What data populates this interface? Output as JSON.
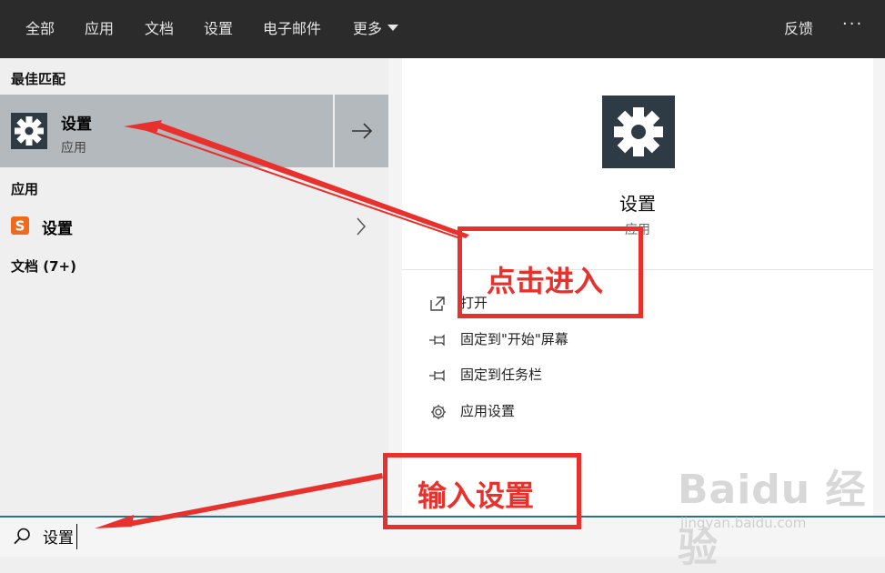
{
  "topbar": {
    "tabs": [
      "全部",
      "应用",
      "文档",
      "设置",
      "电子邮件",
      "更多"
    ],
    "feedback": "反馈",
    "more_menu": "···"
  },
  "left": {
    "best_match_header": "最佳匹配",
    "best_match": {
      "title": "设置",
      "subtitle": "应用"
    },
    "apps_header": "应用",
    "app_item": {
      "title": "设置"
    },
    "docs_header": "文档 (7+)"
  },
  "right": {
    "title": "设置",
    "subtitle": "应用",
    "actions": [
      "打开",
      "固定到\"开始\"屏幕",
      "固定到任务栏",
      "应用设置"
    ]
  },
  "search": {
    "value": "设置"
  },
  "annotations": {
    "click_label": "点击进入",
    "type_label": "输入设置"
  },
  "watermark": {
    "brand": "Baidu 经验",
    "url": "jingyan.baidu.com"
  },
  "colors": {
    "annotation_red": "#e8312c",
    "tile_bg": "#2f3b44",
    "topbar_bg": "#2b2b2b",
    "selected_bg": "#b3b9bc"
  }
}
